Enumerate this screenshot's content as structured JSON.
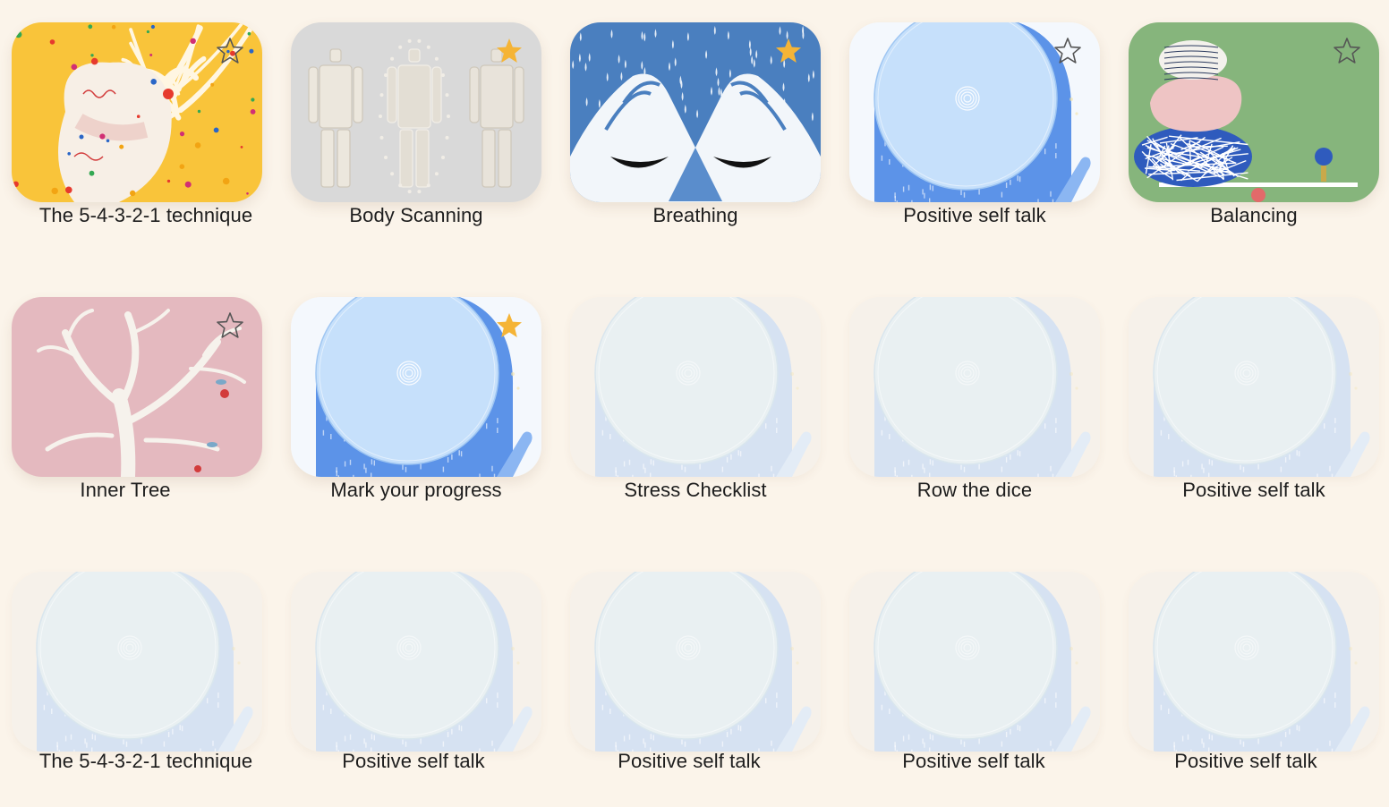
{
  "colors": {
    "background": "#fbf4ea",
    "star_filled": "#f5b436",
    "star_outline": "#555555",
    "text": "#1d1d1d"
  },
  "exercises": [
    {
      "id": "e1",
      "label": "The 5-4-3-2-1 technique",
      "art": "heart",
      "favorite": false,
      "locked": false
    },
    {
      "id": "e2",
      "label": "Body Scanning",
      "art": "body",
      "favorite": true,
      "locked": false
    },
    {
      "id": "e3",
      "label": "Breathing",
      "art": "breathing",
      "favorite": true,
      "locked": false
    },
    {
      "id": "e4",
      "label": "Positive self talk",
      "art": "circle",
      "favorite": false,
      "locked": false
    },
    {
      "id": "e5",
      "label": "Balancing",
      "art": "stones",
      "favorite": false,
      "locked": false
    },
    {
      "id": "e6",
      "label": "Inner Tree",
      "art": "tree",
      "favorite": false,
      "locked": false
    },
    {
      "id": "e7",
      "label": "Mark your progress",
      "art": "circle",
      "favorite": true,
      "locked": false
    },
    {
      "id": "e8",
      "label": "Stress Checklist",
      "art": "circle",
      "favorite": false,
      "locked": true
    },
    {
      "id": "e9",
      "label": "Row the dice",
      "art": "circle",
      "favorite": false,
      "locked": true
    },
    {
      "id": "e10",
      "label": "Positive self talk",
      "art": "circle",
      "favorite": false,
      "locked": true
    },
    {
      "id": "e11",
      "label": "The 5-4-3-2-1 technique",
      "art": "circle",
      "favorite": false,
      "locked": true
    },
    {
      "id": "e12",
      "label": "Positive self talk",
      "art": "circle",
      "favorite": false,
      "locked": true
    },
    {
      "id": "e13",
      "label": "Positive self talk",
      "art": "circle",
      "favorite": false,
      "locked": true
    },
    {
      "id": "e14",
      "label": "Positive self talk",
      "art": "circle",
      "favorite": false,
      "locked": true
    },
    {
      "id": "e15",
      "label": "Positive self talk",
      "art": "circle",
      "favorite": false,
      "locked": true
    }
  ]
}
